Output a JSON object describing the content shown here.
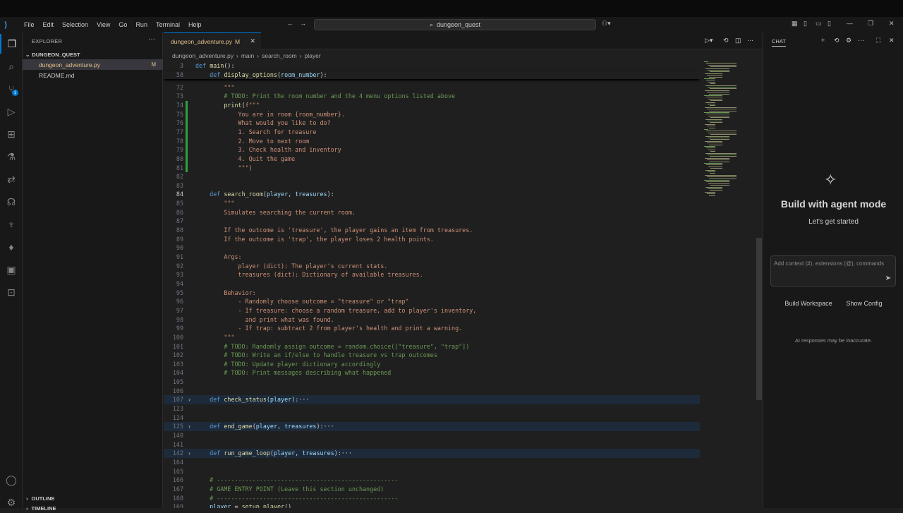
{
  "menu": [
    "File",
    "Edit",
    "Selection",
    "View",
    "Go",
    "Run",
    "Terminal",
    "Help"
  ],
  "search": {
    "text": "dungeon_quest"
  },
  "explorer": {
    "title": "EXPLORER",
    "folder": "DUNGEON_QUEST",
    "files": [
      {
        "name": "dungeon_adventure.py",
        "status": "M"
      },
      {
        "name": "README.md",
        "status": ""
      }
    ],
    "outline": "OUTLINE",
    "timeline": "TIMELINE"
  },
  "activity_badge": "1",
  "tab": {
    "name": "dungeon_adventure.py",
    "status": "M"
  },
  "breadcrumb": [
    "dungeon_adventure.py",
    "main",
    "search_room",
    "player"
  ],
  "sticky": [
    {
      "n": "3",
      "text": "def main():"
    },
    {
      "n": "58",
      "text": "    def display_options(room_number):"
    }
  ],
  "lines": [
    {
      "n": "72",
      "text": "        \"\"\""
    },
    {
      "n": "73",
      "text": "        # TODO: Print the room number and the 4 menu options listed above"
    },
    {
      "n": "74",
      "text": "        print(f\"\"\""
    },
    {
      "n": "75",
      "text": "            You are in room {room_number}."
    },
    {
      "n": "76",
      "text": "            What would you like to do?"
    },
    {
      "n": "77",
      "text": "            1. Search for treasure"
    },
    {
      "n": "78",
      "text": "            2. Move to next room"
    },
    {
      "n": "79",
      "text": "            3. Check health and inventory"
    },
    {
      "n": "80",
      "text": "            4. Quit the game"
    },
    {
      "n": "81",
      "text": "            \"\"\")"
    },
    {
      "n": "82",
      "text": ""
    },
    {
      "n": "83",
      "text": ""
    },
    {
      "n": "84",
      "text": "    def search_room(player, treasures):"
    },
    {
      "n": "85",
      "text": "        \"\"\""
    },
    {
      "n": "86",
      "text": "        Simulates searching the current room."
    },
    {
      "n": "87",
      "text": ""
    },
    {
      "n": "88",
      "text": "        If the outcome is 'treasure', the player gains an item from treasures."
    },
    {
      "n": "89",
      "text": "        If the outcome is 'trap', the player loses 2 health points."
    },
    {
      "n": "90",
      "text": ""
    },
    {
      "n": "91",
      "text": "        Args:"
    },
    {
      "n": "92",
      "text": "            player (dict): The player's current stats."
    },
    {
      "n": "93",
      "text": "            treasures (dict): Dictionary of available treasures."
    },
    {
      "n": "94",
      "text": ""
    },
    {
      "n": "95",
      "text": "        Behavior:"
    },
    {
      "n": "96",
      "text": "            - Randomly choose outcome = \"treasure\" or \"trap\""
    },
    {
      "n": "97",
      "text": "            - If treasure: choose a random treasure, add to player's inventory,"
    },
    {
      "n": "98",
      "text": "              and print what was found."
    },
    {
      "n": "99",
      "text": "            - If trap: subtract 2 from player's health and print a warning."
    },
    {
      "n": "100",
      "text": "        \"\"\""
    },
    {
      "n": "101",
      "text": "        # TODO: Randomly assign outcome = random.choice([\"treasure\", \"trap\"])"
    },
    {
      "n": "102",
      "text": "        # TODO: Write an if/else to handle treasure vs trap outcomes"
    },
    {
      "n": "103",
      "text": "        # TODO: Update player dictionary accordingly"
    },
    {
      "n": "104",
      "text": "        # TODO: Print messages describing what happened"
    },
    {
      "n": "105",
      "text": ""
    },
    {
      "n": "106",
      "text": ""
    },
    {
      "n": "107",
      "text": "    def check_status(player):···"
    },
    {
      "n": "123",
      "text": ""
    },
    {
      "n": "124",
      "text": ""
    },
    {
      "n": "125",
      "text": "    def end_game(player, treasures):···"
    },
    {
      "n": "140",
      "text": ""
    },
    {
      "n": "141",
      "text": ""
    },
    {
      "n": "142",
      "text": "    def run_game_loop(player, treasures):···"
    },
    {
      "n": "164",
      "text": ""
    },
    {
      "n": "165",
      "text": ""
    },
    {
      "n": "166",
      "text": "    # ---------------------------------------------------"
    },
    {
      "n": "167",
      "text": "    # GAME ENTRY POINT (Leave this section unchanged)"
    },
    {
      "n": "168",
      "text": "    # ---------------------------------------------------"
    },
    {
      "n": "169",
      "text": "    player = setup_player()"
    }
  ],
  "chat": {
    "title": "CHAT",
    "heading": "Build with agent mode",
    "sub": "Let's get started",
    "placeholder": "Add context (#), extensions (@), commands",
    "btn1": "Build Workspace",
    "btn2": "Show Config",
    "disclaimer": "AI responses may be inaccurate."
  }
}
